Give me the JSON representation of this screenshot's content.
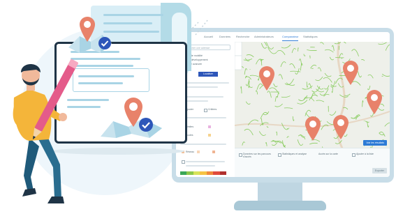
{
  "colors": {
    "pin": "#e8826a",
    "brand_blue": "#2d56b9",
    "accent_blue": "#2d7bd6",
    "map_green": "#7ec850",
    "monitor_frame": "#c8dde8",
    "doc_outline": "#1f3446",
    "shirt": "#f4b53a",
    "pants": "#1f5a7a",
    "pencil": "#e45b8a"
  },
  "app": {
    "nav_tabs": [
      "Accueil",
      "Données",
      "Recherche",
      "Administrateurs",
      "Comparateur",
      "Statistiques"
    ],
    "active_tab": "Comparateur",
    "search_placeholder": "Rechercher une adresse",
    "panel_lines": [
      "Parcours de mobilité",
      "Zones de développement",
      "Recherche avancée"
    ],
    "panel_button": "Localiser",
    "filter_labels": [
      "Ajouter",
      "Critères",
      "Limites",
      "Ecoles",
      "Réseau"
    ],
    "bottom_columns": [
      "Données sur les parcours d'accès",
      "Statistiques et analyse",
      "Accès sur la carte",
      "Ajouter à la liste"
    ],
    "bottom_button": "Voir les résultats",
    "bottom_button_secondary": "Exporter"
  },
  "illustration": {
    "icons": [
      "map-pin-icon",
      "folded-map-icon",
      "check-badge-icon",
      "pencil-icon"
    ]
  }
}
